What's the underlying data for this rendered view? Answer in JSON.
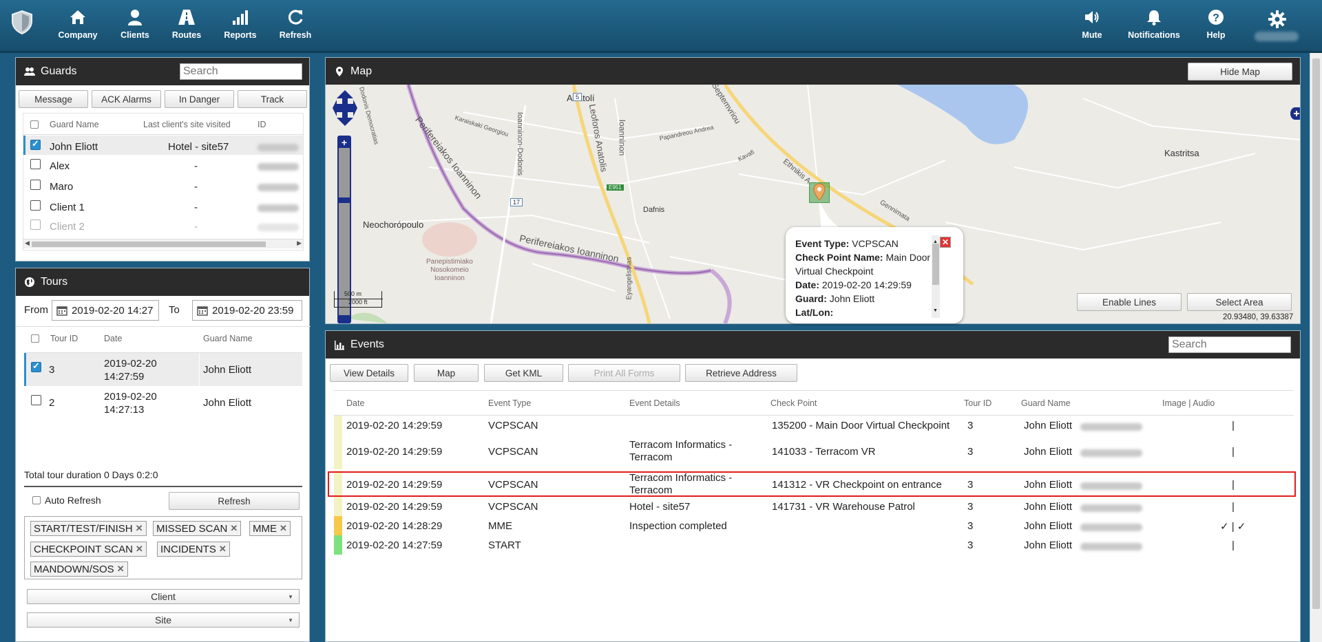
{
  "nav": {
    "left": [
      {
        "label": "Company",
        "icon": "home-icon"
      },
      {
        "label": "Clients",
        "icon": "user-icon"
      },
      {
        "label": "Routes",
        "icon": "road-icon"
      },
      {
        "label": "Reports",
        "icon": "bar-chart-icon"
      },
      {
        "label": "Refresh",
        "icon": "refresh-icon"
      }
    ],
    "right": [
      {
        "label": "Mute",
        "icon": "speaker-icon"
      },
      {
        "label": "Notifications",
        "icon": "bell-icon"
      },
      {
        "label": "Help",
        "icon": "help-icon"
      }
    ]
  },
  "guards": {
    "title": "Guards",
    "search_placeholder": "Search",
    "buttons": [
      "Message",
      "ACK Alarms",
      "In Danger",
      "Track"
    ],
    "headers": {
      "name": "Guard Name",
      "site": "Last client's site visited",
      "id": "ID"
    },
    "rows": [
      {
        "name": "John Eliott",
        "site": "Hotel - site57",
        "checked": true
      },
      {
        "name": "Alex",
        "site": "-",
        "checked": false
      },
      {
        "name": "Maro",
        "site": "-",
        "checked": false
      },
      {
        "name": "Client 1",
        "site": "-",
        "checked": false
      },
      {
        "name": "Client 2",
        "site": "-",
        "checked": false
      }
    ]
  },
  "tours": {
    "title": "Tours",
    "from_label": "From",
    "from_value": "2019-02-20 14:27",
    "to_label": "To",
    "to_value": "2019-02-20 23:59",
    "headers": {
      "tour_id": "Tour ID",
      "date": "Date",
      "guard": "Guard Name"
    },
    "rows": [
      {
        "tour_id": "3",
        "date_line1": "2019-02-20",
        "date_line2": "14:27:59",
        "guard": "John Eliott",
        "checked": true
      },
      {
        "tour_id": "2",
        "date_line1": "2019-02-20",
        "date_line2": "14:27:13",
        "guard": "John Eliott",
        "checked": false
      }
    ],
    "total_duration": "Total tour duration 0 Days 0:2:0",
    "auto_refresh_label": "Auto Refresh",
    "refresh_label": "Refresh",
    "filter_tags": [
      "START/TEST/FINISH",
      "MISSED SCAN",
      "MME",
      "CHECKPOINT SCAN",
      "INCIDENTS",
      "MANDOWN/SOS"
    ],
    "client_select": "Client",
    "site_select": "Site"
  },
  "map": {
    "title": "Map",
    "hide_label": "Hide Map",
    "enable_lines_label": "Enable Lines",
    "select_area_label": "Select Area",
    "coordinates": "20.93480, 39.63387",
    "scale_m": "500 m",
    "scale_ft": "2000 ft",
    "labels": {
      "anatoli": "Anatolí",
      "kastritsa": "Kastritsa",
      "neochoropoulo": "Neochorópoulo",
      "dafnis": "Dafnis",
      "peri1": "Perifereiakos Ioanninon",
      "peri2": "Perifereiakos Ioanninon",
      "leoforos": "Leoforos Anatolis",
      "ioanninon": "Ioanninon",
      "ioanninon_dodonis": "Ioanninon-Dodonis",
      "septemvriou": "Septemvriou",
      "papandreou": "Papandreou Andrea",
      "kavafi": "Kavafi",
      "ethnikis": "Ethnikis A",
      "gennimata": "Gennimata",
      "karaiskaki": "Karaiskaki Georgiou",
      "eyangelistrias": "Eyangelistrias",
      "hospital": "Panepistimiako Nosokomeio Ioanninon",
      "hospital_l1": "Panepistimiako",
      "hospital_l2": "Nosokomeio",
      "hospital_l3": "Ioanninon",
      "road_5": "5",
      "road_17": "17",
      "road_e951": "E951",
      "dodonis": "Dodonis Democratias"
    },
    "popup": {
      "event_type_label": "Event Type:",
      "event_type": "VCPSCAN",
      "checkpoint_label": "Check Point Name:",
      "checkpoint": "Main Door",
      "checkpoint_2": "Virtual Checkpoint",
      "date_label": "Date:",
      "date": "2019-02-20 14:29:59",
      "guard_label": "Guard:",
      "guard": "John Eliott",
      "latlon_label": "Lat/Lon:"
    }
  },
  "events": {
    "title": "Events",
    "search_placeholder": "Search",
    "buttons": [
      "View Details",
      "Map",
      "Get KML",
      "Print All Forms",
      "Retrieve Address"
    ],
    "headers": {
      "date": "Date",
      "type": "Event Type",
      "details": "Event Details",
      "checkpoint": "Check Point",
      "tour": "Tour ID",
      "guard": "Guard Name",
      "media": "Image | Audio"
    },
    "rows": [
      {
        "date": "2019-02-20 14:29:59",
        "type": "VCPSCAN",
        "details": "",
        "details2": "",
        "checkpoint": "135200 - Main Door Virtual Checkpoint",
        "tour": "3",
        "guard": "John Eliott",
        "media": "|",
        "color": "#f2f2c4"
      },
      {
        "date": "2019-02-20 14:29:59",
        "type": "VCPSCAN",
        "details": "Terracom Informatics -",
        "details2": "Terracom",
        "checkpoint": "141033 - Terracom VR",
        "tour": "3",
        "guard": "John Eliott",
        "media": "|",
        "color": "#f2f2c4"
      },
      {
        "date": "2019-02-20 14:29:59",
        "type": "VCPSCAN",
        "details": "Terracom Informatics -",
        "details2": "Terracom",
        "checkpoint": "141312 - VR Checkpoint on entrance",
        "tour": "3",
        "guard": "John Eliott",
        "media": "|",
        "color": "#f2f2c4"
      },
      {
        "date": "2019-02-20 14:29:59",
        "type": "VCPSCAN",
        "details": "Hotel - site57",
        "details2": "",
        "checkpoint": "141731 - VR Warehouse Patrol",
        "tour": "3",
        "guard": "John Eliott",
        "media": "|",
        "color": "#f2f2c4"
      },
      {
        "date": "2019-02-20 14:28:29",
        "type": "MME",
        "details": "Inspection completed",
        "details2": "",
        "checkpoint": "",
        "tour": "3",
        "guard": "John Eliott",
        "media": "✓ | ✓",
        "color": "#f7c94a"
      },
      {
        "date": "2019-02-20 14:27:59",
        "type": "START",
        "details": "",
        "details2": "",
        "checkpoint": "",
        "tour": "3",
        "guard": "John Eliott",
        "media": "|",
        "color": "#7ee07e"
      }
    ]
  }
}
